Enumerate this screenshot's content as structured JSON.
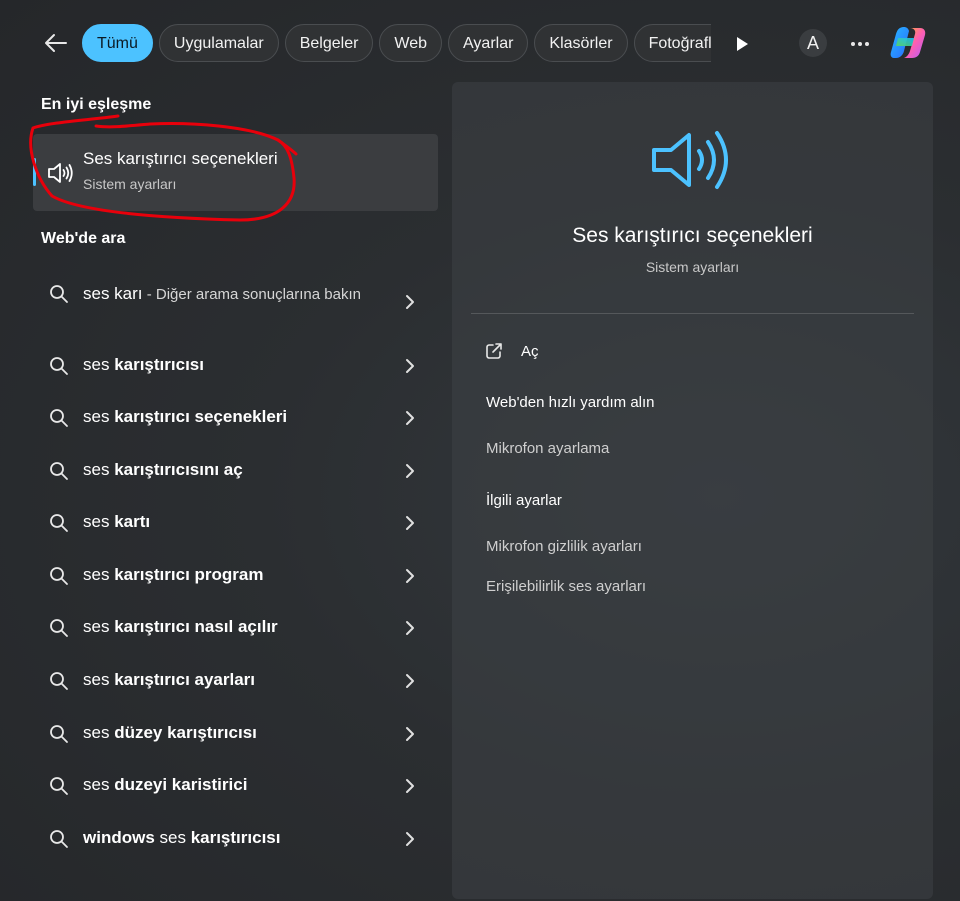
{
  "topbar": {
    "tabs": [
      {
        "label": "Tümü",
        "active": true
      },
      {
        "label": "Uygulamalar"
      },
      {
        "label": "Belgeler"
      },
      {
        "label": "Web"
      },
      {
        "label": "Ayarlar"
      },
      {
        "label": "Klasörler"
      },
      {
        "label": "Fotoğraflar"
      }
    ],
    "avatar_letter": "A",
    "icons": [
      "back-arrow-icon",
      "play-icon",
      "more-icon",
      "copilot-icon"
    ]
  },
  "left": {
    "best_match_title": "En iyi eşleşme",
    "best_match": {
      "title": "Ses karıştırıcı seçenekleri",
      "subtitle": "Sistem ayarları",
      "icon": "speaker-icon"
    },
    "web_title": "Web'de ara",
    "web_first": {
      "bold": "ses karı",
      "muted": " - Diğer arama sonuçlarına bakın"
    },
    "web_items": [
      {
        "prefix": "ses ",
        "bold": "karıştırıcısı"
      },
      {
        "prefix": "ses ",
        "bold": "karıştırıcı seçenekleri"
      },
      {
        "prefix": "ses ",
        "bold": "karıştırıcısını aç"
      },
      {
        "prefix": "ses ",
        "bold": "kartı"
      },
      {
        "prefix": "ses ",
        "bold": "karıştırıcı program"
      },
      {
        "prefix": "ses ",
        "bold": "karıştırıcı nasıl açılır"
      },
      {
        "prefix": "ses ",
        "bold": "karıştırıcı ayarları"
      },
      {
        "prefix": "ses ",
        "bold": "düzey karıştırıcısı"
      },
      {
        "prefix": "ses ",
        "bold": "duzeyi karistirici"
      },
      {
        "prefix": "windows ses ",
        "bold": "karıştırıcısı",
        "bold_prefix": "windows"
      }
    ]
  },
  "detail": {
    "title": "Ses karıştırıcı seçenekleri",
    "subtitle": "Sistem ayarları",
    "open_label": "Aç",
    "web_help_heading": "Web'den hızlı yardım alın",
    "web_help_link": "Mikrofon ayarlama",
    "related_heading": "İlgili ayarlar",
    "related_links": [
      "Mikrofon gizlilik ayarları",
      "Erişilebilirlik ses ayarları"
    ]
  },
  "colors": {
    "accent": "#4cc2ff",
    "annotation": "#e8000b",
    "background": "#2b2e31"
  }
}
